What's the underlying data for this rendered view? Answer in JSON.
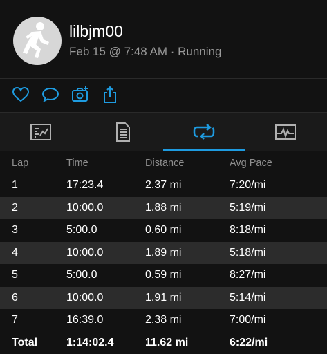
{
  "activity": {
    "username": "lilbjm00",
    "meta": "Feb 15 @ 7:48 AM · Running"
  },
  "actions": {
    "icons": [
      "heart-icon",
      "comment-icon",
      "add-photo-icon",
      "share-icon"
    ]
  },
  "tabs": {
    "items": [
      "summary-tab",
      "details-tab",
      "laps-tab",
      "chart-tab"
    ],
    "active": "laps-tab",
    "accent_color": "#1e9be0"
  },
  "laps": {
    "headers": [
      "Lap",
      "Time",
      "Distance",
      "Avg Pace"
    ],
    "rows": [
      [
        "1",
        "17:23.4",
        "2.37 mi",
        "7:20/mi"
      ],
      [
        "2",
        "10:00.0",
        "1.88 mi",
        "5:19/mi"
      ],
      [
        "3",
        "5:00.0",
        "0.60 mi",
        "8:18/mi"
      ],
      [
        "4",
        "10:00.0",
        "1.89 mi",
        "5:18/mi"
      ],
      [
        "5",
        "5:00.0",
        "0.59 mi",
        "8:27/mi"
      ],
      [
        "6",
        "10:00.0",
        "1.91 mi",
        "5:14/mi"
      ],
      [
        "7",
        "16:39.0",
        "2.38 mi",
        "7:00/mi"
      ]
    ],
    "total": [
      "Total",
      "1:14:02.4",
      "11.62 mi",
      "6:22/mi"
    ]
  }
}
